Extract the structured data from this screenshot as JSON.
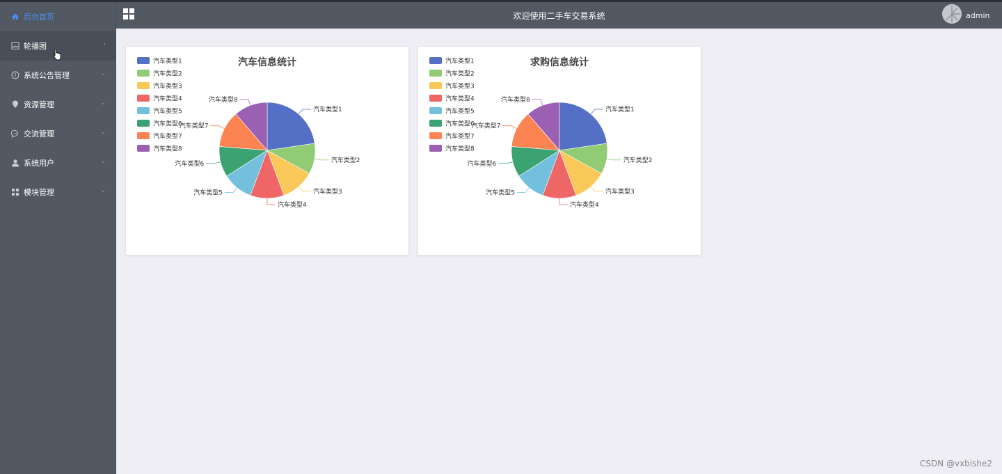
{
  "sidebar": {
    "items": [
      {
        "label": "后台首页",
        "icon": "home-icon",
        "active": true,
        "arrow": ""
      },
      {
        "label": "轮播图",
        "icon": "picture-icon",
        "arrow": "‹"
      },
      {
        "label": "系统公告管理",
        "icon": "info-icon",
        "arrow": "⌄"
      },
      {
        "label": "资源管理",
        "icon": "location-pin-icon",
        "arrow": "⌄"
      },
      {
        "label": "交流管理",
        "icon": "chat-icon",
        "arrow": "⌄"
      },
      {
        "label": "系统用户",
        "icon": "user-icon",
        "arrow": "⌄"
      },
      {
        "label": "模块管理",
        "icon": "grid-icon",
        "arrow": "⌄"
      }
    ]
  },
  "header": {
    "title": "欢迎使用二手车交易系统",
    "username": "admin"
  },
  "watermark": "CSDN @vxbishe2",
  "colors": {
    "sidebar_bg": "#525963",
    "active_text": "#4a8ff0",
    "page_bg": "#f0eef5"
  },
  "chart_data": [
    {
      "type": "pie",
      "title": "汽车信息统计",
      "legend_position": "top-left",
      "categories": [
        "汽车类型1",
        "汽车类型2",
        "汽车类型3",
        "汽车类型4",
        "汽车类型5",
        "汽车类型6",
        "汽车类型7",
        "汽车类型8"
      ],
      "values": [
        22,
        10,
        11,
        11,
        10,
        10,
        12,
        11
      ],
      "colors": [
        "#5470c6",
        "#91cc75",
        "#fac858",
        "#ee6666",
        "#73c0de",
        "#3ba272",
        "#fc8452",
        "#9a60b4"
      ]
    },
    {
      "type": "pie",
      "title": "求购信息统计",
      "legend_position": "top-left",
      "categories": [
        "汽车类型1",
        "汽车类型2",
        "汽车类型3",
        "汽车类型4",
        "汽车类型5",
        "汽车类型6",
        "汽车类型7",
        "汽车类型8"
      ],
      "values": [
        22,
        10,
        11,
        11,
        10,
        10,
        12,
        11
      ],
      "colors": [
        "#5470c6",
        "#91cc75",
        "#fac858",
        "#ee6666",
        "#73c0de",
        "#3ba272",
        "#fc8452",
        "#9a60b4"
      ]
    }
  ]
}
